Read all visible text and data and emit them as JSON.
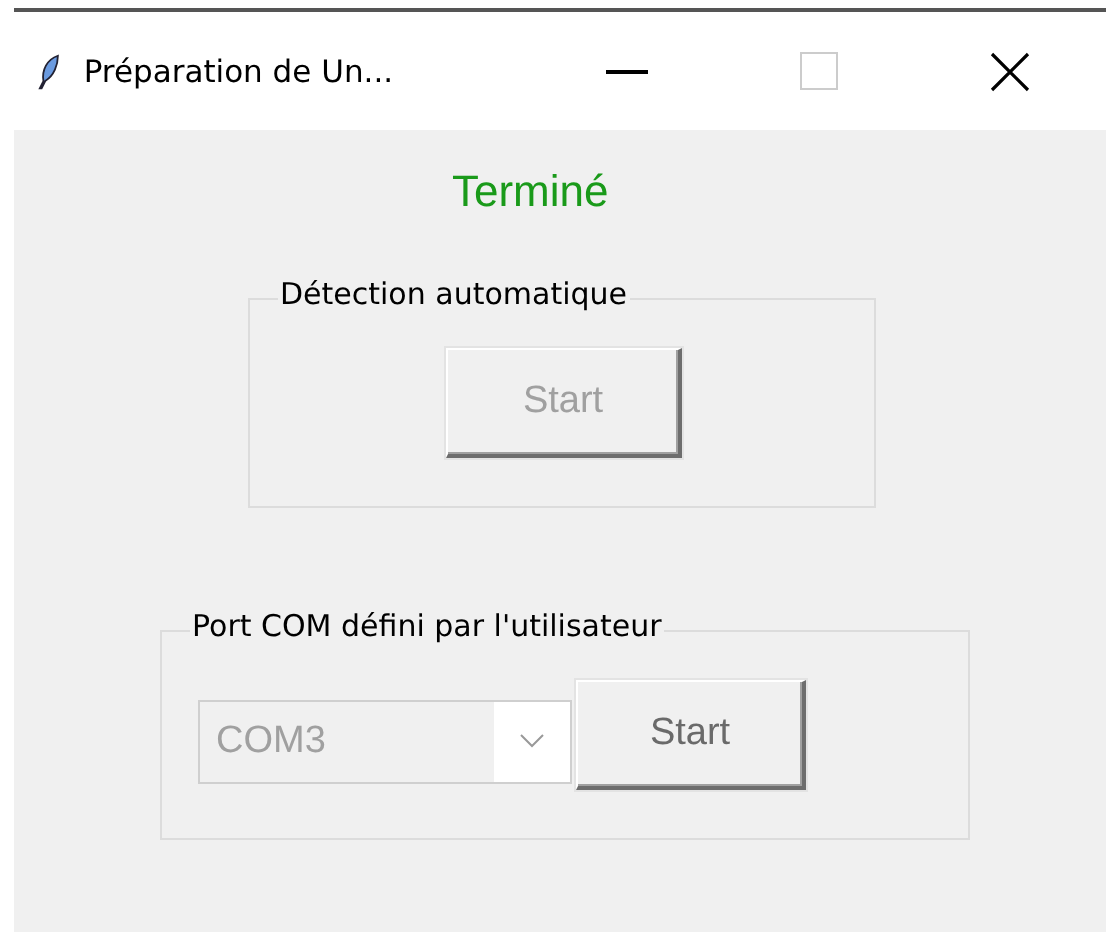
{
  "window": {
    "title": "Préparation de Un..."
  },
  "status": {
    "text": "Terminé"
  },
  "auto_detection": {
    "label": "Détection automatique",
    "button": {
      "label": "Start",
      "disabled": true
    }
  },
  "user_port": {
    "label": "Port COM défini par l'utilisateur",
    "port_select": {
      "value": "COM3",
      "disabled": true
    },
    "button": {
      "label": "Start",
      "disabled": false
    }
  }
}
